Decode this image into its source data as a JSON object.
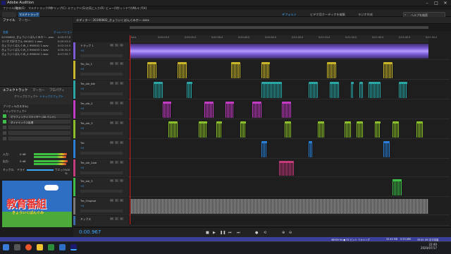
{
  "window": {
    "title": "Adobe Audition"
  },
  "menu": [
    "ファイル(F)",
    "編集(E)",
    "マルチトラック(M)",
    "クリップ(C)",
    "エフェクト(S)",
    "お気に入り(R)",
    "ビュー(V)",
    "ウィンドウ(W)",
    "ヘルプ(H)"
  ],
  "workspaces": [
    "デフォルト",
    "ビデオ用オーディオを編集",
    "ラジオ作成"
  ],
  "help_search": {
    "placeholder": "ヘルプを検索"
  },
  "files_panel": {
    "tabs": [
      "ファイル",
      "マーカー"
    ],
    "col_name": "名前",
    "col_dur": "デュレーション",
    "rows": [
      {
        "name": "20190802_きょういくばんぐみホー...wav",
        "dur": "0:05:57.6"
      },
      {
        "name": "ラジオ大好きさん 990001 1.wav",
        "dur": "0:00:03.0"
      },
      {
        "name": "きょういくばんぐみ_1 990002 1.wav",
        "dur": "0:02:19.0"
      },
      {
        "name": "きょういくばんぐみ_3 990003 1.wav",
        "dur": "0:00:30.0"
      },
      {
        "name": "きょういくばんぐみ_4 990004 1.wav",
        "dur": "0:07:59.7"
      }
    ]
  },
  "effects_panel": {
    "tabs": [
      "エフェクトラック",
      "マーカー",
      "プロパティ"
    ],
    "subtabs": [
      "クリップエフェクト",
      "トラックエフェクト"
    ],
    "preset_label": "プリセット:",
    "preset_value": "(カスタム)",
    "track_label": "トラックエフェクト",
    "racks": [
      "グラフィックイコライザー (30 バンド)",
      "ダイナミックス処理",
      "",
      "",
      ""
    ],
    "input_label": "入力:",
    "output_label": "出力:",
    "mix_label": "ミックス:",
    "mix_modes": [
      "ドライ",
      "ウエット"
    ],
    "mix_value": "100 %",
    "db_in": "0 dB",
    "db_out": "0 dB"
  },
  "thumbnail": {
    "logo": "教育番組",
    "kana": "きょういくばんぐみ"
  },
  "editor": {
    "title": "エディター: 20190802_きょういくばんぐみホー.sesx",
    "timecode": "0:00.967",
    "ruler": [
      "hms",
      "0:00:10.0",
      "0:00:20.0",
      "0:00:30.0",
      "0:00:40.0",
      "0:00:50.0",
      "0:01:00.0",
      "0:01:10.0",
      "0:01:20.0",
      "0:01:30.0",
      "0:01:40.0",
      "0:01:50.0"
    ],
    "tracks": [
      {
        "name": "トラック 1",
        "color": "#7b5bd6",
        "vol": "+0",
        "clips": [
          {
            "l": 0.0,
            "w": 1.0
          }
        ]
      },
      {
        "name": "Tre_Go_1",
        "color": "#c9b52a",
        "vol": "+0",
        "clips": [
          {
            "l": 0.06,
            "w": 0.03
          },
          {
            "l": 0.16,
            "w": 0.03
          },
          {
            "l": 0.34,
            "w": 0.03
          },
          {
            "l": 0.44,
            "w": 0.03
          },
          {
            "l": 0.66,
            "w": 0.03
          },
          {
            "l": 0.85,
            "w": 0.03
          }
        ]
      },
      {
        "name": "Tre_ale_ble",
        "color": "#2aa6a6",
        "vol": "+0",
        "clips": [
          {
            "l": 0.08,
            "w": 0.03
          },
          {
            "l": 0.19,
            "w": 0.02
          },
          {
            "l": 0.44,
            "w": 0.07
          },
          {
            "l": 0.6,
            "w": 0.03
          },
          {
            "l": 0.67,
            "w": 0.03
          },
          {
            "l": 0.74,
            "w": 0.01
          },
          {
            "l": 0.77,
            "w": 0.01
          },
          {
            "l": 0.8,
            "w": 0.04
          },
          {
            "l": 0.9,
            "w": 0.03
          }
        ]
      },
      {
        "name": "Tre_ale_2",
        "color": "#c43bc4",
        "vol": "+0",
        "clips": [
          {
            "l": 0.11,
            "w": 0.03
          },
          {
            "l": 0.25,
            "w": 0.03
          },
          {
            "l": 0.32,
            "w": 0.03
          },
          {
            "l": 0.41,
            "w": 0.03
          },
          {
            "l": 0.51,
            "w": 0.03
          }
        ]
      },
      {
        "name": "Tre_ale_3",
        "color": "#8bbf2a",
        "vol": "+0",
        "clips": [
          {
            "l": 0.13,
            "w": 0.03
          },
          {
            "l": 0.23,
            "w": 0.03
          },
          {
            "l": 0.29,
            "w": 0.02
          },
          {
            "l": 0.37,
            "w": 0.02
          },
          {
            "l": 0.52,
            "w": 0.02
          },
          {
            "l": 0.63,
            "w": 0.02
          },
          {
            "l": 0.72,
            "w": 0.02
          },
          {
            "l": 0.76,
            "w": 0.02
          },
          {
            "l": 0.82,
            "w": 0.02
          },
          {
            "l": 0.88,
            "w": 0.02
          },
          {
            "l": 0.96,
            "w": 0.02
          }
        ]
      },
      {
        "name": "Tre",
        "color": "#2a7fd6",
        "vol": "+0",
        "clips": [
          {
            "l": 0.44,
            "w": 0.02
          },
          {
            "l": 0.6,
            "w": 0.01
          },
          {
            "l": 0.85,
            "w": 0.02
          }
        ]
      },
      {
        "name": "Tre_ale_2ale",
        "color": "#c43b7b",
        "vol": "+0",
        "clips": [
          {
            "l": 0.5,
            "w": 0.05
          }
        ]
      },
      {
        "name": "Tre_ale_3",
        "color": "#3fbf4a",
        "vol": "+0",
        "clips": [
          {
            "l": 0.88,
            "w": 0.03
          }
        ]
      },
      {
        "name": "Tre_Original",
        "color": "#7a7a7a",
        "vol": "+0",
        "clips": [
          {
            "l": 0.0,
            "w": 1.0
          }
        ]
      },
      {
        "name": "ミックス",
        "color": "#3a6ea6",
        "vol": "+0",
        "clips": []
      }
    ]
  },
  "status": {
    "left": "",
    "right": "48000 Hz ● 32 ビット ミキシング",
    "size": "33.45 MB",
    "dur": "5:33.080",
    "free": "39.81 GB 空き容量"
  },
  "clock": {
    "time": "22:40",
    "date": "2020/07/17"
  },
  "colors": {
    "accent": "#3da6ff",
    "statusbar": "#3b3f9a"
  }
}
